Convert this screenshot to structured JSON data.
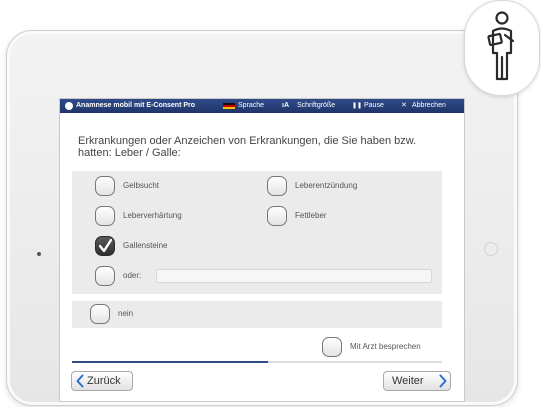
{
  "topbar": {
    "app_title": "Anamnese mobil mit E-Consent Pro",
    "language": "Sprache",
    "font_size_icon": "ıA",
    "font_size": "Schriftgröße",
    "pause_icon": "❚❚",
    "pause": "Pause",
    "cancel_icon": "✕",
    "cancel": "Abbrechen"
  },
  "question": "Erkrankungen oder Anzeichen von Erkrankungen, die Sie haben bzw. hatten: Leber / Galle:",
  "options": [
    {
      "label": "Gelbsucht",
      "checked": false
    },
    {
      "label": "Leberentzündung",
      "checked": false
    },
    {
      "label": "Leberverhärtung",
      "checked": false
    },
    {
      "label": "Fettleber",
      "checked": false
    },
    {
      "label": "Gallensteine",
      "checked": true
    }
  ],
  "other": {
    "label": "oder:",
    "value": "",
    "checked": false
  },
  "none": {
    "label": "nein",
    "checked": false
  },
  "discuss": {
    "label": "Mit Arzt besprechen",
    "checked": false
  },
  "progress": 0.53,
  "nav": {
    "back": "Zurück",
    "next": "Weiter"
  },
  "icons": {
    "app": "app-logo-icon",
    "flag": "german-flag-icon",
    "badge": "patient-with-tablet-icon"
  },
  "colors": {
    "accent": "#2f4b8a",
    "panel": "#ebebeb"
  }
}
